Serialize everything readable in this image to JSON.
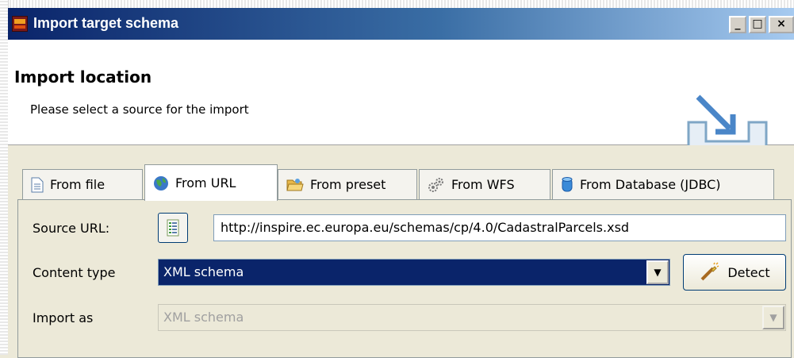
{
  "window": {
    "title": "Import target schema",
    "min": "_",
    "max": "□",
    "close": "×"
  },
  "header": {
    "title": "Import location",
    "description": "Please select a source for the import"
  },
  "tabs": [
    {
      "label": "From file",
      "icon": "file-icon"
    },
    {
      "label": "From URL",
      "icon": "globe-icon",
      "selected": true
    },
    {
      "label": "From preset",
      "icon": "folder-icon"
    },
    {
      "label": "From WFS",
      "icon": "gears-icon"
    },
    {
      "label": "From Database (JDBC)",
      "icon": "database-icon"
    }
  ],
  "form": {
    "source_url_label": "Source URL:",
    "source_url_value": "http://inspire.ec.europa.eu/schemas/cp/4.0/CadastralParcels.xsd",
    "content_type_label": "Content type",
    "content_type_value": "XML schema",
    "detect_label": "Detect",
    "import_as_label": "Import as",
    "import_as_value": "XML schema",
    "arrow": "▼"
  }
}
